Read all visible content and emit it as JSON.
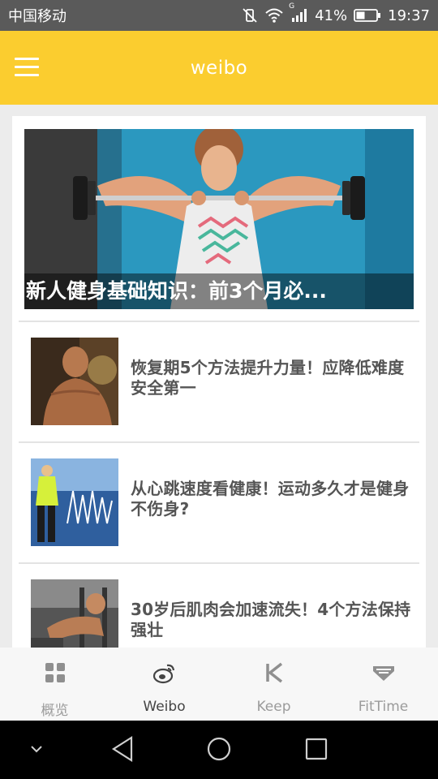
{
  "status_bar": {
    "carrier": "中国移动",
    "battery": "41%",
    "time": "19:37",
    "network": "G"
  },
  "app_bar": {
    "title": "weibo"
  },
  "featured": {
    "title": "新人健身基础知识：前3个月必..."
  },
  "news": [
    {
      "title": "恢复期5个方法提升力量！应降低难度安全第一"
    },
    {
      "title": "从心跳速度看健康！运动多久才是健身不伤身?"
    },
    {
      "title": "30岁后肌肉会加速流失！4个方法保持强壮"
    }
  ],
  "bottom_nav": [
    {
      "label": "概览",
      "icon": "grid-icon",
      "active": false
    },
    {
      "label": "Weibo",
      "icon": "weibo-icon",
      "active": true
    },
    {
      "label": "Keep",
      "icon": "keep-icon",
      "active": false
    },
    {
      "label": "FitTime",
      "icon": "fittime-icon",
      "active": false
    }
  ],
  "colors": {
    "accent": "#fbcd2f",
    "status_bar": "#5a5a5a",
    "title_text": "#555555"
  }
}
